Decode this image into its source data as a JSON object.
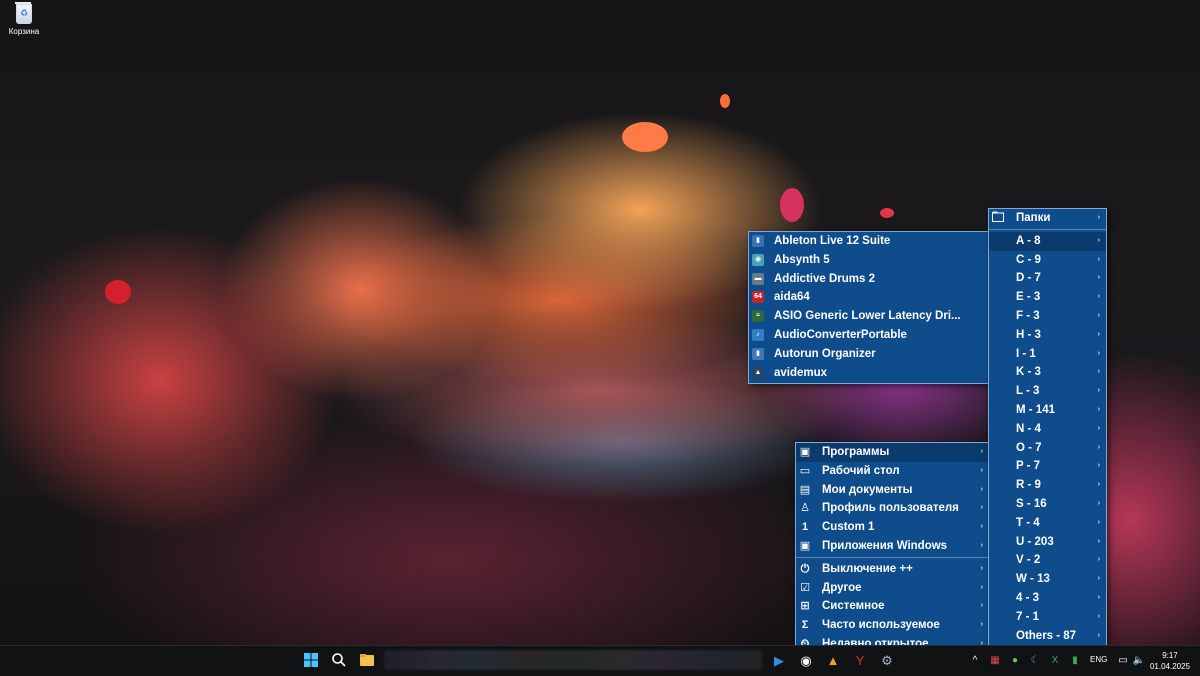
{
  "desktop": {
    "recycle_bin_label": "Корзина"
  },
  "main_menu": {
    "items": [
      {
        "label": "Программы",
        "icon": "monitor-icon",
        "glyph": "▣",
        "arrow": "›"
      },
      {
        "label": "Рабочий стол",
        "icon": "desktop-icon",
        "glyph": "▭",
        "arrow": "›"
      },
      {
        "label": "Мои документы",
        "icon": "document-icon",
        "glyph": "▤",
        "arrow": "›"
      },
      {
        "label": "Профиль пользователя",
        "icon": "user-icon",
        "glyph": "♙",
        "arrow": "›"
      },
      {
        "label": "Custom 1",
        "icon": "number-one-icon",
        "glyph": "1",
        "arrow": "›"
      },
      {
        "label": "Приложения Windows",
        "icon": "windows-apps-icon",
        "glyph": "▣",
        "arrow": "›"
      },
      {
        "label": "Выключение ++",
        "icon": "power-icon",
        "glyph": "⏻",
        "arrow": "›"
      },
      {
        "label": "Другое",
        "icon": "check-monitor-icon",
        "glyph": "☑",
        "arrow": "›"
      },
      {
        "label": "Системное",
        "icon": "windows-logo-icon",
        "glyph": "⊞",
        "arrow": "›"
      },
      {
        "label": "Часто используемое",
        "icon": "sigma-icon",
        "glyph": "Σ",
        "arrow": "›"
      },
      {
        "label": "Недавно открытое",
        "icon": "recent-icon",
        "glyph": "⏲",
        "arrow": "›"
      }
    ]
  },
  "programs_menu": {
    "items": [
      {
        "label": "Ableton Live 12 Suite",
        "icon": "ableton-icon",
        "glyph": "▮",
        "color": "#3a6fb0"
      },
      {
        "label": "Absynth 5",
        "icon": "absynth-icon",
        "glyph": "◉",
        "color": "#4aa0b8"
      },
      {
        "label": "Addictive Drums 2",
        "icon": "addictive-drums-icon",
        "glyph": "▬",
        "color": "#6a7a8a"
      },
      {
        "label": "aida64",
        "icon": "aida64-icon",
        "glyph": "64",
        "color": "#c0262c"
      },
      {
        "label": "ASIO Generic Lower Latency Dri...",
        "icon": "asio-icon",
        "glyph": "≈",
        "color": "#2e6a3a"
      },
      {
        "label": "AudioConverterPortable",
        "icon": "audio-converter-icon",
        "glyph": "♪",
        "color": "#2f7fc8"
      },
      {
        "label": "Autorun Organizer",
        "icon": "autorun-icon",
        "glyph": "▮",
        "color": "#3f78b8"
      },
      {
        "label": "avidemux",
        "icon": "avidemux-icon",
        "glyph": "▲",
        "color": "#23466a"
      }
    ]
  },
  "folders_menu": {
    "header": {
      "label": "Папки",
      "icon": "folder-icon",
      "arrow": "›"
    },
    "items": [
      {
        "label": "A - 8",
        "arrow": "›"
      },
      {
        "label": "C - 9",
        "arrow": "›"
      },
      {
        "label": "D - 7",
        "arrow": "›"
      },
      {
        "label": "E - 3",
        "arrow": "›"
      },
      {
        "label": "F - 3",
        "arrow": "›"
      },
      {
        "label": "H - 3",
        "arrow": "›"
      },
      {
        "label": "I - 1",
        "arrow": "›"
      },
      {
        "label": "K - 3",
        "arrow": "›"
      },
      {
        "label": "L - 3",
        "arrow": "›"
      },
      {
        "label": "M - 141",
        "arrow": "›"
      },
      {
        "label": "N - 4",
        "arrow": "›"
      },
      {
        "label": "O - 7",
        "arrow": "›"
      },
      {
        "label": "P - 7",
        "arrow": "›"
      },
      {
        "label": "R - 9",
        "arrow": "›"
      },
      {
        "label": "S - 16",
        "arrow": "›"
      },
      {
        "label": "T - 4",
        "arrow": "›"
      },
      {
        "label": "U - 203",
        "arrow": "›"
      },
      {
        "label": "V - 2",
        "arrow": "›"
      },
      {
        "label": "W - 13",
        "arrow": "›"
      },
      {
        "label": "4 - 3",
        "arrow": "›"
      },
      {
        "label": "7 - 1",
        "arrow": "›"
      },
      {
        "label": "Others - 87",
        "arrow": "›"
      }
    ]
  },
  "taskbar": {
    "tray_language": "ENG",
    "time": "9:17",
    "date": "01.04.2025",
    "chevron": "^"
  },
  "colors": {
    "menu_bg": "#0f4c8c",
    "menu_selected": "#0b3a6d",
    "menu_border": "#7fa8d6",
    "taskbar_bg": "#111214"
  }
}
